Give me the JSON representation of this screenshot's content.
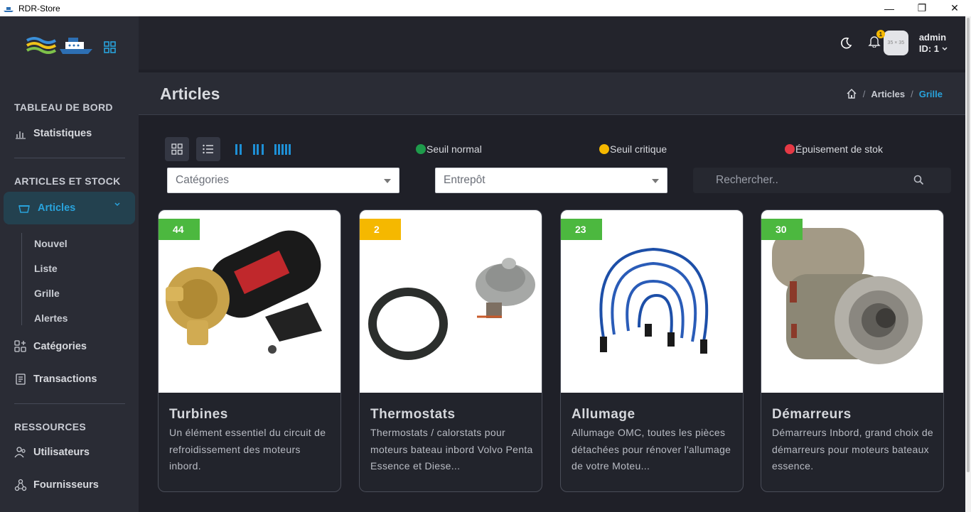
{
  "window": {
    "title": "RDR-Store"
  },
  "sidebar": {
    "sections": [
      {
        "title": "TABLEAU DE BORD"
      },
      {
        "title": "ARTICLES ET STOCK"
      },
      {
        "title": "RESSOURCES"
      }
    ],
    "items": {
      "statistiques": "Statistiques",
      "articles": "Articles",
      "categories": "Catégories",
      "transactions": "Transactions",
      "utilisateurs": "Utilisateurs",
      "fournisseurs": "Fournisseurs"
    },
    "sub_items": [
      "Nouvel",
      "Liste",
      "Grille",
      "Alertes"
    ]
  },
  "topbar": {
    "notification_count": "1",
    "avatar_text": "35 × 35",
    "user_name": "admin",
    "user_id": "ID: 1"
  },
  "header": {
    "title": "Articles",
    "breadcrumb": [
      "Articles",
      "Grille"
    ]
  },
  "legend": [
    {
      "label": "Seuil normal",
      "color": "#1e9b4b"
    },
    {
      "label": "Seuil critique",
      "color": "#f5b800"
    },
    {
      "label": "Épuisement de stok",
      "color": "#e53945"
    }
  ],
  "filters": {
    "category_placeholder": "Catégories",
    "warehouse_placeholder": "Entrepôt",
    "search_placeholder": "Rechercher.."
  },
  "cards": [
    {
      "qty": "44",
      "qty_color": "#4cb83f",
      "name": "Turbines",
      "desc": "Un élément essentiel du circuit de refroidissement des moteurs inbord."
    },
    {
      "qty": "2",
      "qty_color": "#f5b800",
      "name": "Thermostats",
      "desc": "Thermostats / calorstats pour moteurs bateau inbord Volvo Penta Essence et Diese..."
    },
    {
      "qty": "23",
      "qty_color": "#4cb83f",
      "name": "Allumage",
      "desc": "Allumage OMC, toutes les pièces détachées pour rénover l'allumage de votre Moteu..."
    },
    {
      "qty": "30",
      "qty_color": "#4cb83f",
      "name": "Démarreurs",
      "desc": "Démarreurs Inbord, grand choix de démarreurs pour moteurs bateaux essence."
    }
  ]
}
